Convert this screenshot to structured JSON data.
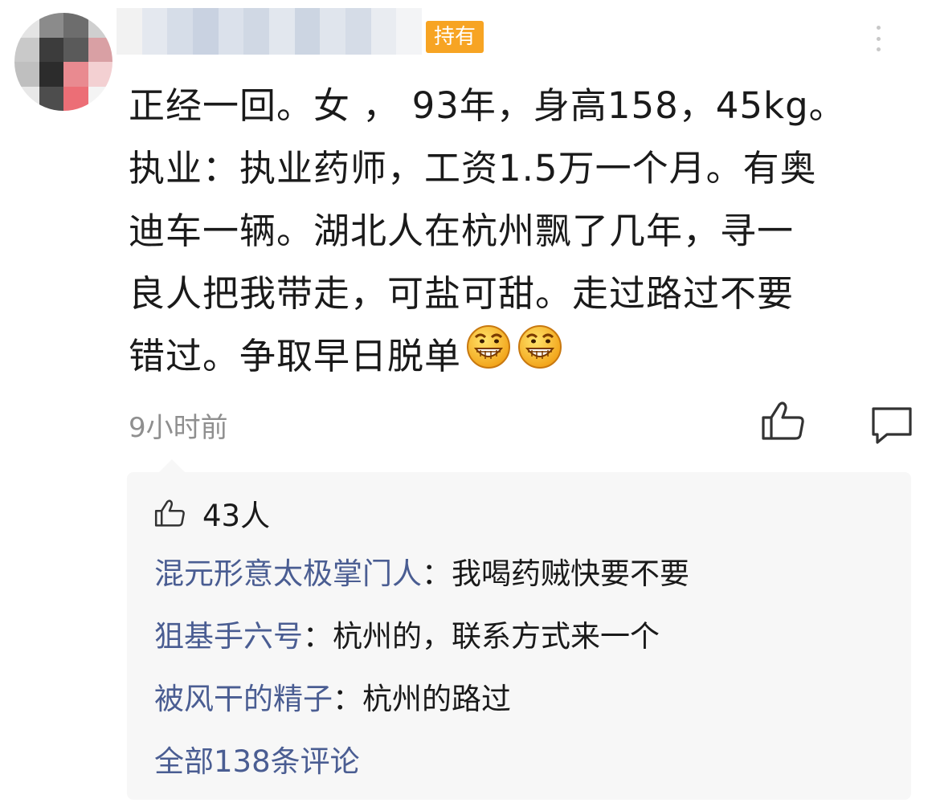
{
  "post": {
    "badge": "持有",
    "lines": [
      "正经一回。女 ， 93年，身高158，45kg。",
      "执业：执业药师，工资1.5万一个月。有奥",
      "迪车一辆。湖北人在杭州飘了几年，寻一",
      "良人把我带走，可盐可甜。走过路过不要",
      "错过。争取早日脱单"
    ],
    "emoji": [
      "grinning-face-emoji",
      "grinning-face-emoji"
    ],
    "timestamp": "9小时前"
  },
  "replies": {
    "likes_count": "43人",
    "items": [
      {
        "author": "混元形意太极掌门人",
        "content": "：我喝药贼快要不要"
      },
      {
        "author": "狙基手六号",
        "content": "：杭州的，联系方式来一个"
      },
      {
        "author": "被风干的精子",
        "content": "：杭州的路过"
      }
    ],
    "view_all": "全部138条评论"
  },
  "icons": {
    "like": "thumbs-up-icon",
    "comment": "comment-icon",
    "more": "more-vertical-icon"
  },
  "colors": {
    "badge": "#f7a423",
    "author_link": "#4a5d92",
    "timestamp": "#8f8f8f",
    "reply_bg": "#f7f7f7"
  }
}
